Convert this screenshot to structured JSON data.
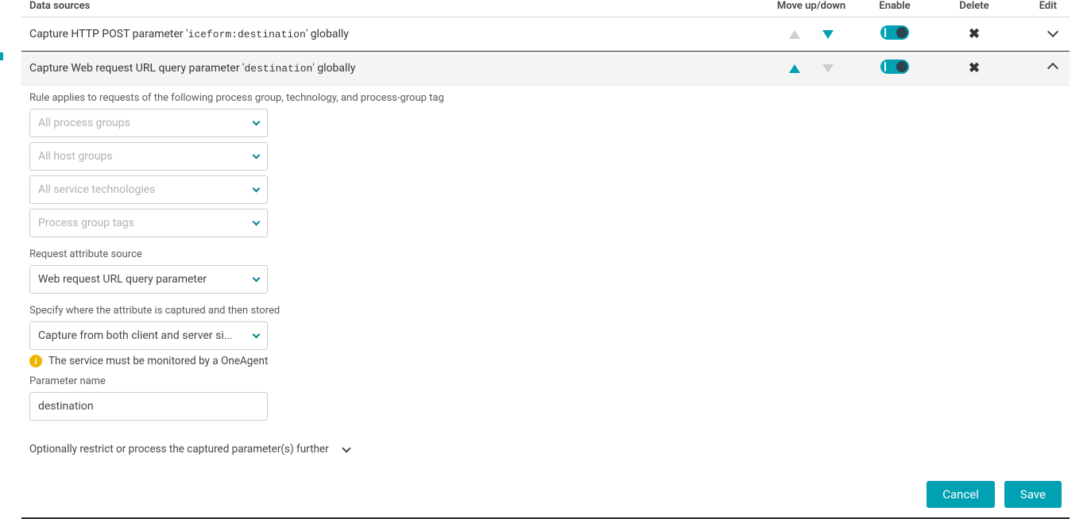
{
  "table": {
    "headers": {
      "source": "Data sources",
      "move": "Move up/down",
      "enable": "Enable",
      "delete": "Delete",
      "edit": "Edit"
    },
    "rows": [
      {
        "prefix": "Capture HTTP POST parameter '",
        "param": "iceform:destination",
        "suffix": "' globally"
      },
      {
        "prefix": "Capture Web request URL query parameter '",
        "param": "destination",
        "suffix": "' globally"
      }
    ]
  },
  "details": {
    "applies_label": "Rule applies to requests of the following process group, technology, and process-group tag",
    "selects": {
      "process_groups": "All process groups",
      "host_groups": "All host groups",
      "technologies": "All service technologies",
      "tags": "Process group tags"
    },
    "source_label": "Request attribute source",
    "source_value": "Web request URL query parameter",
    "capture_label": "Specify where the attribute is captured and then stored",
    "capture_value": "Capture from both client and server si...",
    "info_text": "The service must be monitored by a OneAgent",
    "param_label": "Parameter name",
    "param_value": "destination",
    "restrict_label": "Optionally restrict or process the captured parameter(s) further"
  },
  "footer": {
    "cancel": "Cancel",
    "save": "Save"
  }
}
